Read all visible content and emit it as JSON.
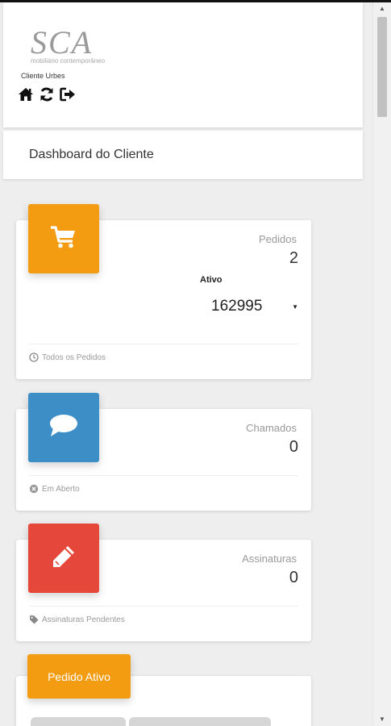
{
  "header": {
    "logo_text": "SCA",
    "logo_subtitle": "mobiliário contemporâneo",
    "client_name": "Cliente Urbes",
    "icons": [
      "home-icon",
      "refresh-icon",
      "logout-icon"
    ]
  },
  "page": {
    "title": "Dashboard do Cliente"
  },
  "cards": {
    "orders": {
      "category": "Pedidos",
      "value": "2",
      "status_label": "Ativo",
      "selected_order": "162995",
      "footer": "Todos os Pedidos",
      "color": "#f39c12",
      "icon": "cart-icon",
      "footer_icon": "clock-icon"
    },
    "tickets": {
      "category": "Chamados",
      "value": "0",
      "footer": "Em Aberto",
      "color": "#3d8ec6",
      "icon": "chat-bubble-icon",
      "footer_icon": "close-circle-icon"
    },
    "signatures": {
      "category": "Assinaturas",
      "value": "0",
      "footer": "Assinaturas Pendentes",
      "color": "#e5483a",
      "icon": "pencil-icon",
      "footer_icon": "tag-icon"
    }
  },
  "active_order": {
    "title": "Pedido Ativo",
    "color": "#f39c12"
  }
}
